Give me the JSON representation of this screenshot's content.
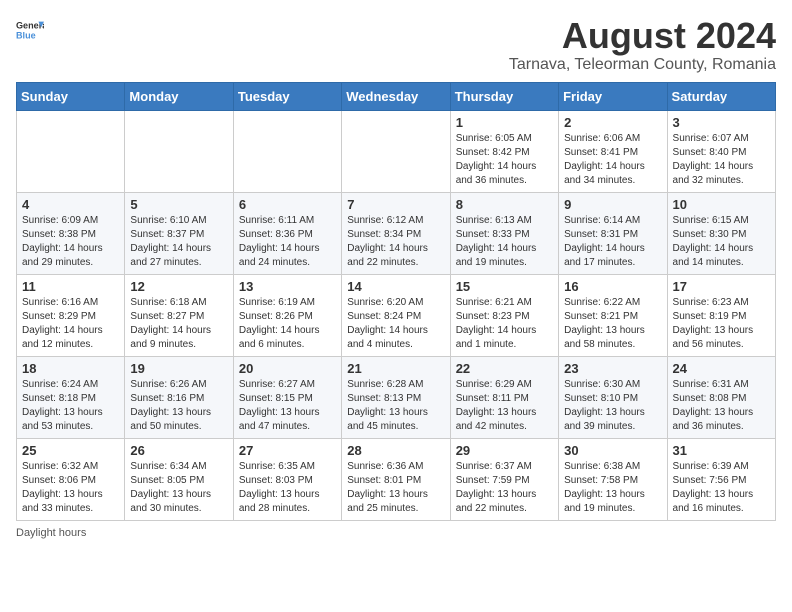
{
  "header": {
    "logo_general": "General",
    "logo_blue": "Blue",
    "main_title": "August 2024",
    "subtitle": "Tarnava, Teleorman County, Romania"
  },
  "days_of_week": [
    "Sunday",
    "Monday",
    "Tuesday",
    "Wednesday",
    "Thursday",
    "Friday",
    "Saturday"
  ],
  "weeks": [
    [
      {
        "day": "",
        "info": ""
      },
      {
        "day": "",
        "info": ""
      },
      {
        "day": "",
        "info": ""
      },
      {
        "day": "",
        "info": ""
      },
      {
        "day": "1",
        "info": "Sunrise: 6:05 AM\nSunset: 8:42 PM\nDaylight: 14 hours\nand 36 minutes."
      },
      {
        "day": "2",
        "info": "Sunrise: 6:06 AM\nSunset: 8:41 PM\nDaylight: 14 hours\nand 34 minutes."
      },
      {
        "day": "3",
        "info": "Sunrise: 6:07 AM\nSunset: 8:40 PM\nDaylight: 14 hours\nand 32 minutes."
      }
    ],
    [
      {
        "day": "4",
        "info": "Sunrise: 6:09 AM\nSunset: 8:38 PM\nDaylight: 14 hours\nand 29 minutes."
      },
      {
        "day": "5",
        "info": "Sunrise: 6:10 AM\nSunset: 8:37 PM\nDaylight: 14 hours\nand 27 minutes."
      },
      {
        "day": "6",
        "info": "Sunrise: 6:11 AM\nSunset: 8:36 PM\nDaylight: 14 hours\nand 24 minutes."
      },
      {
        "day": "7",
        "info": "Sunrise: 6:12 AM\nSunset: 8:34 PM\nDaylight: 14 hours\nand 22 minutes."
      },
      {
        "day": "8",
        "info": "Sunrise: 6:13 AM\nSunset: 8:33 PM\nDaylight: 14 hours\nand 19 minutes."
      },
      {
        "day": "9",
        "info": "Sunrise: 6:14 AM\nSunset: 8:31 PM\nDaylight: 14 hours\nand 17 minutes."
      },
      {
        "day": "10",
        "info": "Sunrise: 6:15 AM\nSunset: 8:30 PM\nDaylight: 14 hours\nand 14 minutes."
      }
    ],
    [
      {
        "day": "11",
        "info": "Sunrise: 6:16 AM\nSunset: 8:29 PM\nDaylight: 14 hours\nand 12 minutes."
      },
      {
        "day": "12",
        "info": "Sunrise: 6:18 AM\nSunset: 8:27 PM\nDaylight: 14 hours\nand 9 minutes."
      },
      {
        "day": "13",
        "info": "Sunrise: 6:19 AM\nSunset: 8:26 PM\nDaylight: 14 hours\nand 6 minutes."
      },
      {
        "day": "14",
        "info": "Sunrise: 6:20 AM\nSunset: 8:24 PM\nDaylight: 14 hours\nand 4 minutes."
      },
      {
        "day": "15",
        "info": "Sunrise: 6:21 AM\nSunset: 8:23 PM\nDaylight: 14 hours\nand 1 minute."
      },
      {
        "day": "16",
        "info": "Sunrise: 6:22 AM\nSunset: 8:21 PM\nDaylight: 13 hours\nand 58 minutes."
      },
      {
        "day": "17",
        "info": "Sunrise: 6:23 AM\nSunset: 8:19 PM\nDaylight: 13 hours\nand 56 minutes."
      }
    ],
    [
      {
        "day": "18",
        "info": "Sunrise: 6:24 AM\nSunset: 8:18 PM\nDaylight: 13 hours\nand 53 minutes."
      },
      {
        "day": "19",
        "info": "Sunrise: 6:26 AM\nSunset: 8:16 PM\nDaylight: 13 hours\nand 50 minutes."
      },
      {
        "day": "20",
        "info": "Sunrise: 6:27 AM\nSunset: 8:15 PM\nDaylight: 13 hours\nand 47 minutes."
      },
      {
        "day": "21",
        "info": "Sunrise: 6:28 AM\nSunset: 8:13 PM\nDaylight: 13 hours\nand 45 minutes."
      },
      {
        "day": "22",
        "info": "Sunrise: 6:29 AM\nSunset: 8:11 PM\nDaylight: 13 hours\nand 42 minutes."
      },
      {
        "day": "23",
        "info": "Sunrise: 6:30 AM\nSunset: 8:10 PM\nDaylight: 13 hours\nand 39 minutes."
      },
      {
        "day": "24",
        "info": "Sunrise: 6:31 AM\nSunset: 8:08 PM\nDaylight: 13 hours\nand 36 minutes."
      }
    ],
    [
      {
        "day": "25",
        "info": "Sunrise: 6:32 AM\nSunset: 8:06 PM\nDaylight: 13 hours\nand 33 minutes."
      },
      {
        "day": "26",
        "info": "Sunrise: 6:34 AM\nSunset: 8:05 PM\nDaylight: 13 hours\nand 30 minutes."
      },
      {
        "day": "27",
        "info": "Sunrise: 6:35 AM\nSunset: 8:03 PM\nDaylight: 13 hours\nand 28 minutes."
      },
      {
        "day": "28",
        "info": "Sunrise: 6:36 AM\nSunset: 8:01 PM\nDaylight: 13 hours\nand 25 minutes."
      },
      {
        "day": "29",
        "info": "Sunrise: 6:37 AM\nSunset: 7:59 PM\nDaylight: 13 hours\nand 22 minutes."
      },
      {
        "day": "30",
        "info": "Sunrise: 6:38 AM\nSunset: 7:58 PM\nDaylight: 13 hours\nand 19 minutes."
      },
      {
        "day": "31",
        "info": "Sunrise: 6:39 AM\nSunset: 7:56 PM\nDaylight: 13 hours\nand 16 minutes."
      }
    ]
  ],
  "footer": {
    "daylight_label": "Daylight hours"
  }
}
